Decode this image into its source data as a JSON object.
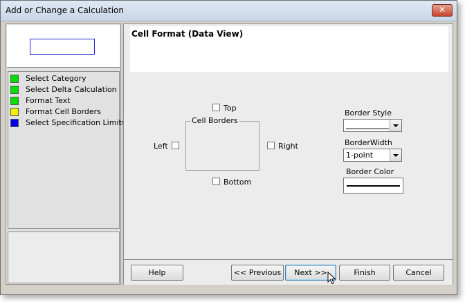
{
  "window": {
    "title": "Add or Change a Calculation",
    "close_glyph": "✕"
  },
  "sidebar": {
    "steps": [
      {
        "label": "Select Category",
        "color": "#00e000"
      },
      {
        "label": "Select Delta Calculation",
        "color": "#00e000"
      },
      {
        "label": "Format Text",
        "color": "#00e000"
      },
      {
        "label": "Format Cell Borders",
        "color": "#f0f000"
      },
      {
        "label": "Select Specification Limits",
        "color": "#0000e0"
      }
    ]
  },
  "main": {
    "title": "Cell Format (Data View)",
    "borders": {
      "group_label": "Cell Borders",
      "top": "Top",
      "left": "Left",
      "right": "Right",
      "bottom": "Bottom"
    },
    "border_style": {
      "label": "Border Style",
      "value": ""
    },
    "border_width": {
      "label": "BorderWidth",
      "value": "1-point"
    },
    "border_color": {
      "label": "Border Color"
    }
  },
  "footer": {
    "help": "Help",
    "previous": "<< Previous",
    "next": "Next >>",
    "finish": "Finish",
    "cancel": "Cancel"
  }
}
